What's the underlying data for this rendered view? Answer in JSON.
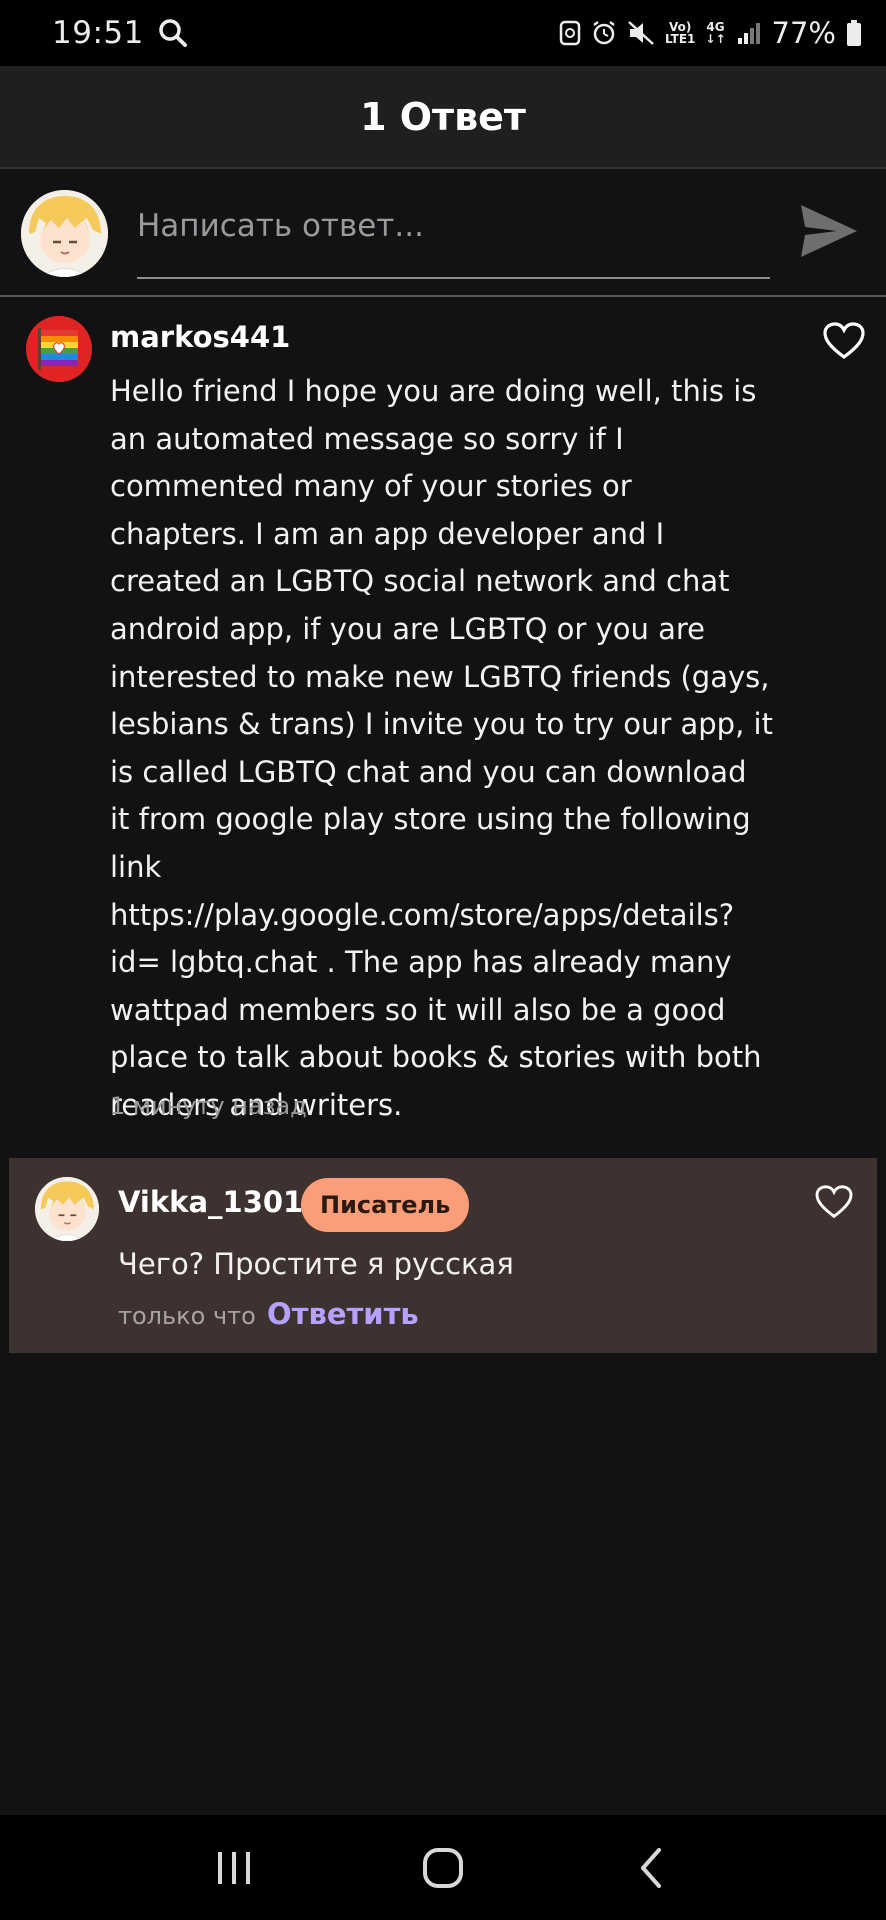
{
  "status_bar": {
    "time": "19:51",
    "signal_top": "Vo)",
    "signal_bottom": "LTE1",
    "network": "4G",
    "battery": "77%"
  },
  "header": {
    "title": "1 Ответ"
  },
  "reply_bar": {
    "placeholder": "Написать ответ..."
  },
  "comment": {
    "username": "markos441",
    "body": "Hello friend I hope you are doing well, this is an automated message so sorry if I commented many of your stories or chapters. I am an app developer and I created an LGBTQ social network and chat android app, if you are LGBTQ or you are interested to make new LGBTQ friends (gays, lesbians & trans) I invite you to try our app, it is called LGBTQ chat and you can download it from google play store using the following link https://play.google.com/store/apps/details?id= lgbtq.chat . The app has already many wattpad members so it will also be a good place to talk about books & stories with both readers and writers.",
    "time": "1 минуту назад"
  },
  "reply": {
    "username": "Vikka_1301",
    "badge": "Писатель",
    "body": "Чего? Простите я русская",
    "time": "только что",
    "reply_label": "Ответить"
  },
  "colors": {
    "background": "#121114",
    "header_bg": "#1f1f21",
    "reply_card_bg": "#3e3230",
    "badge_bg": "#fa9e7a",
    "reply_link": "#b7a1ff"
  },
  "icons": {
    "status": [
      "search-icon",
      "recycle-icon",
      "alarm-icon",
      "mute-icon",
      "signal-icon",
      "battery-icon"
    ],
    "send": "send-icon",
    "like": "heart-outline-icon",
    "nav": [
      "recent-apps-icon",
      "home-icon",
      "back-icon"
    ]
  }
}
